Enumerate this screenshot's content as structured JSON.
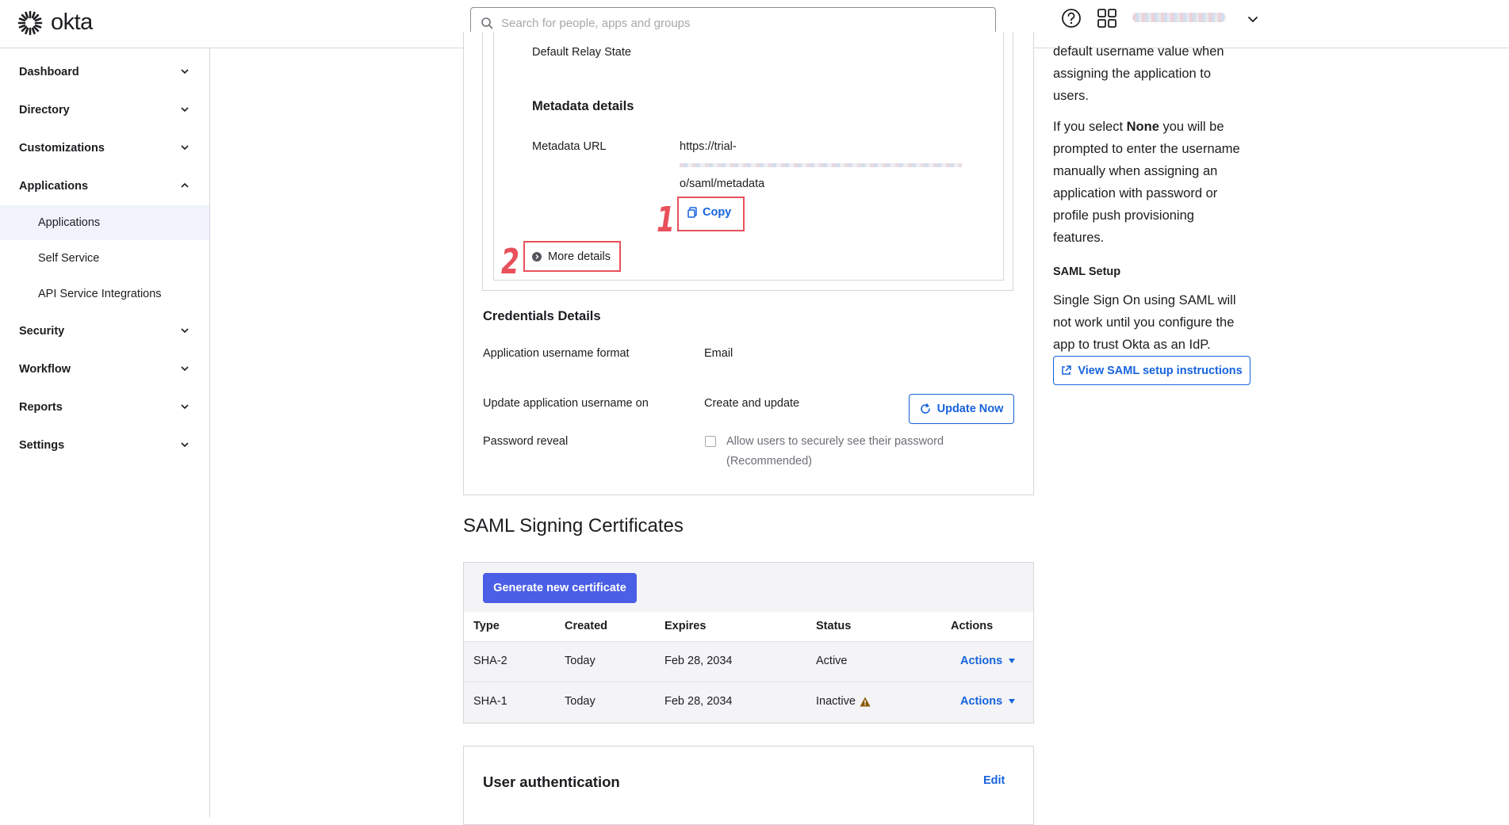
{
  "header": {
    "logo_text": "okta",
    "search_placeholder": "Search for people, apps and groups"
  },
  "sidebar": {
    "items": [
      {
        "label": "Dashboard"
      },
      {
        "label": "Directory"
      },
      {
        "label": "Customizations"
      },
      {
        "label": "Applications"
      },
      {
        "label": "Security"
      },
      {
        "label": "Workflow"
      },
      {
        "label": "Reports"
      },
      {
        "label": "Settings"
      }
    ],
    "sub_items": [
      {
        "label": "Applications"
      },
      {
        "label": "Self Service"
      },
      {
        "label": "API Service Integrations"
      }
    ]
  },
  "saml_panel": {
    "default_relay_state_label": "Default Relay State",
    "metadata_heading": "Metadata details",
    "metadata_url_label": "Metadata URL",
    "metadata_url_line1": "https://trial-",
    "metadata_url_line3": "o/saml/metadata",
    "copy_label": "Copy",
    "more_details_label": "More details"
  },
  "annotations": {
    "one": "1",
    "two": "2"
  },
  "credentials": {
    "heading": "Credentials Details",
    "username_format_label": "Application username format",
    "username_format_value": "Email",
    "update_on_label": "Update application username on",
    "update_on_value": "Create and update",
    "update_now_label": "Update Now",
    "password_reveal_label": "Password reveal",
    "password_reveal_option_line1": "Allow users to securely see their password",
    "password_reveal_option_line2": "(Recommended)"
  },
  "certificates": {
    "heading": "SAML Signing Certificates",
    "generate_label": "Generate new certificate",
    "columns": [
      "Type",
      "Created",
      "Expires",
      "Status",
      "Actions"
    ],
    "rows": [
      {
        "type": "SHA-2",
        "created": "Today",
        "expires": "Feb 28, 2034",
        "status": "Active",
        "actions": "Actions"
      },
      {
        "type": "SHA-1",
        "created": "Today",
        "expires": "Feb 28, 2034",
        "status": "Inactive",
        "actions": "Actions"
      }
    ]
  },
  "user_auth": {
    "heading": "User authentication",
    "edit_label": "Edit"
  },
  "help": {
    "lines_top": [
      "default username value when",
      "assigning the application to",
      "users."
    ],
    "none_prefix": "If you select ",
    "none_word": "None",
    "none_suffix": " you will be",
    "lines_none": [
      "prompted to enter the username",
      "manually when assigning an",
      "application with password or",
      "profile push provisioning",
      "features."
    ],
    "saml_setup_heading": "SAML Setup",
    "saml_setup_lines": [
      "Single Sign On using SAML will",
      "not work until you configure the",
      "app to trust Okta as an IdP."
    ],
    "view_instructions_label": "View SAML setup instructions"
  },
  "colors": {
    "accent": "#1662dd",
    "primary_button": "#4a5ee6",
    "annotation": "#e8505b",
    "active_nav_bg": "#f0f3fc"
  }
}
